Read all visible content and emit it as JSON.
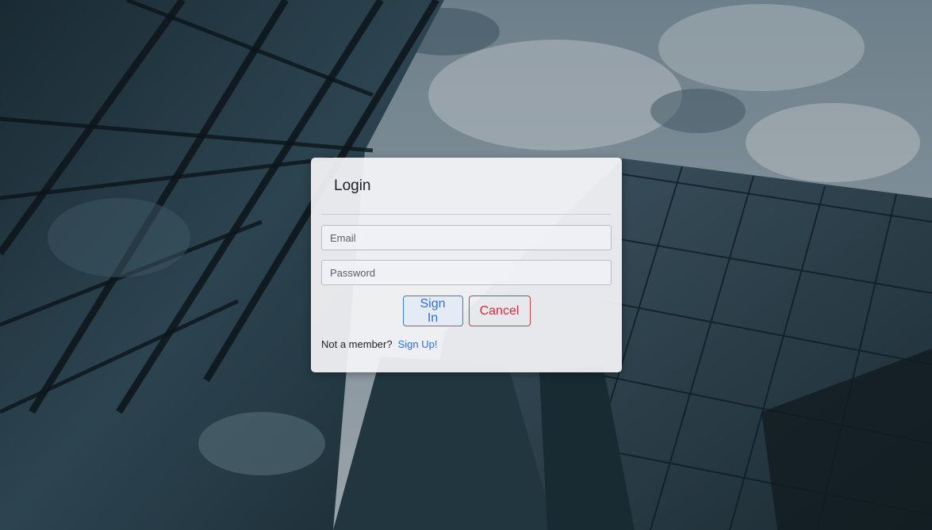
{
  "login": {
    "title": "Login",
    "email_placeholder": "Email",
    "password_placeholder": "Password",
    "sign_in_label": "Sign In",
    "cancel_label": "Cancel",
    "not_member_text": "Not a member?",
    "sign_up_label": "Sign Up!"
  },
  "colors": {
    "primary": "#2f6fd0",
    "danger": "#cc2e3a"
  }
}
